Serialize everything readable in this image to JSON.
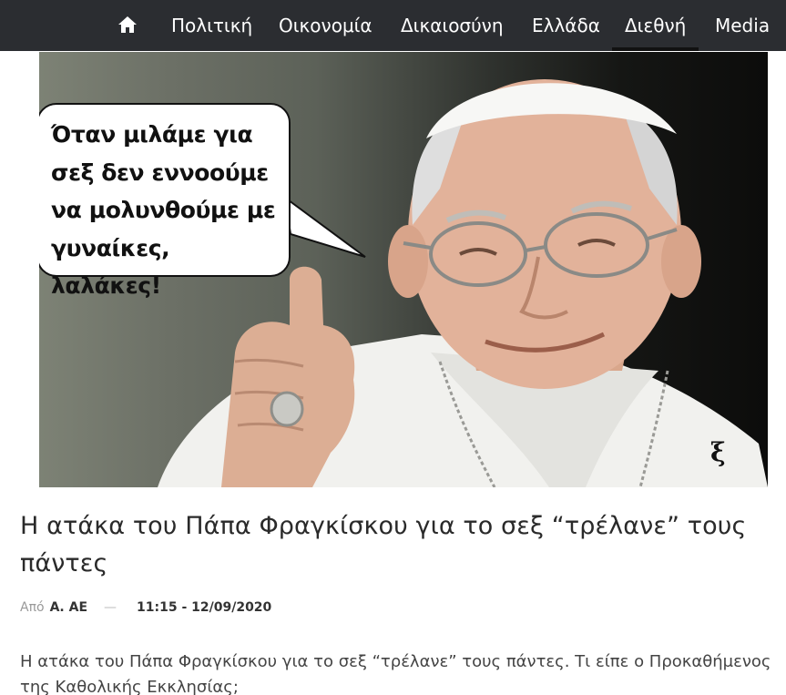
{
  "nav": {
    "home_icon": "home-icon",
    "items": [
      {
        "label": "Πολιτική"
      },
      {
        "label": "Οικονομία"
      },
      {
        "label": "Δικαιοσύνη"
      },
      {
        "label": "Ελλάδα"
      },
      {
        "label": "Διεθνή",
        "active": true
      },
      {
        "label": "Media"
      }
    ],
    "bg_color": "#2b2d31"
  },
  "hero": {
    "speech_bubble": "Όταν μιλάμε για\nσεξ δεν εννοούμε\nνα μολυνθούμε με\nγυναίκες, λαλάκες!",
    "watermark": "ξ"
  },
  "article": {
    "headline": "Η ατάκα του Πάπα Φραγκίσκου για το σεξ “τρέλανε” τους πάντες",
    "byline_prefix": "Από",
    "author": "Α. ΑΕ",
    "separator": "—",
    "datetime": "11:15 - 12/09/2020",
    "lead": "Η ατάκα του Πάπα Φραγκίσκου για το σεξ “τρέλανε” τους πάντες. Τι είπε ο Προκαθήμενος της Καθολικής Εκκλησίας;"
  }
}
